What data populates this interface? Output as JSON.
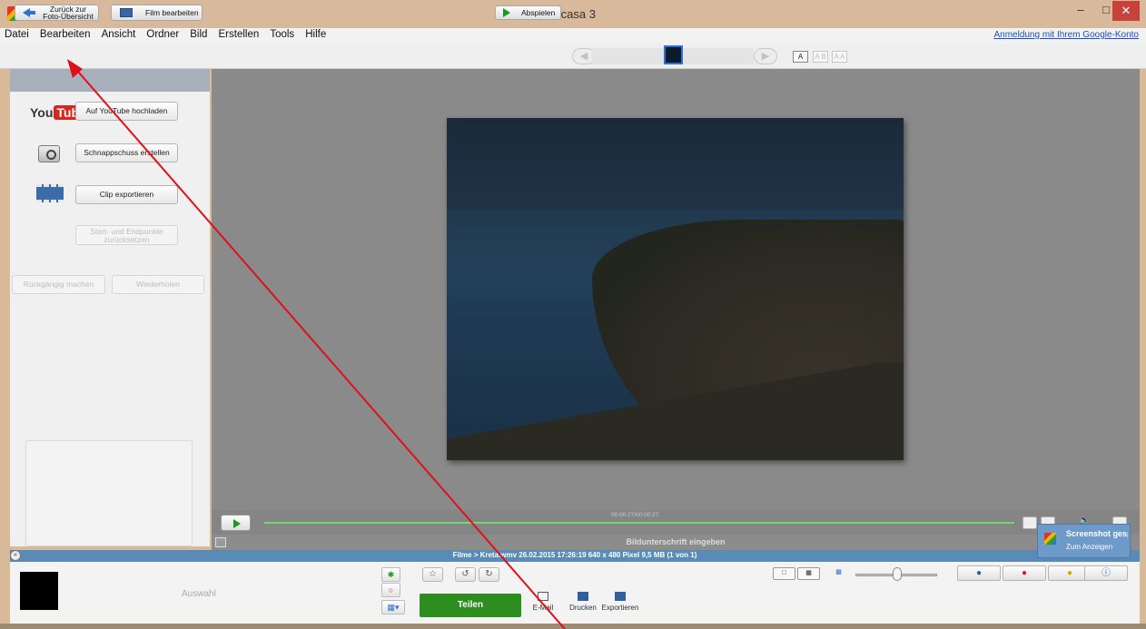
{
  "window": {
    "title": "Picasa 3",
    "minimize_glyph": "–",
    "maximize_glyph": "□",
    "close_glyph": "✕"
  },
  "menu": {
    "items": [
      "Datei",
      "Bearbeiten",
      "Ansicht",
      "Ordner",
      "Bild",
      "Erstellen",
      "Tools",
      "Hilfe"
    ],
    "login_link": "Anmeldung mit Ihrem Google-Konto"
  },
  "toolbar": {
    "back_label": "Zurück zur Foto-Übersicht",
    "film_label": "Film bearbeiten",
    "play_label": "Abspielen",
    "caption_modes": [
      "A",
      "A B",
      "A A"
    ]
  },
  "left_panel": {
    "youtube_logo_you": "You",
    "youtube_logo_tube": "Tube",
    "youtube_button": "Auf YouTube hochladen",
    "snapshot_button": "Schnappschuss erstellen",
    "export_clip_button": "Clip exportieren",
    "reset_points_button": "Start- und Endpunkte zurücksetzen",
    "undo_button": "Rückgängig machen",
    "redo_button": "Wiederholen"
  },
  "playback": {
    "time": "00:00:27/00:00:27",
    "progress": 1.0,
    "volume_icon": "🔈"
  },
  "caption": {
    "placeholder": "Bildunterschrift eingeben"
  },
  "info": {
    "text": "Filme > Kreta.wmv    26.02.2015 17:26:19   640 x 480 Pixel   9,5 MB   (1 von 1)"
  },
  "tray": {
    "label": "Auswahl"
  },
  "actions": {
    "share": "Teilen",
    "email": "E-Mail",
    "print": "Drucken",
    "export": "Exportieren"
  },
  "toast": {
    "title": "Screenshot gespeichert",
    "subtitle": "Zum Anzeigen"
  },
  "colors": {
    "titlebar": "#d9b99b",
    "share_green": "#2d8d1f",
    "info_blue": "#5a8bb6",
    "annotation_red": "#e0101a"
  }
}
